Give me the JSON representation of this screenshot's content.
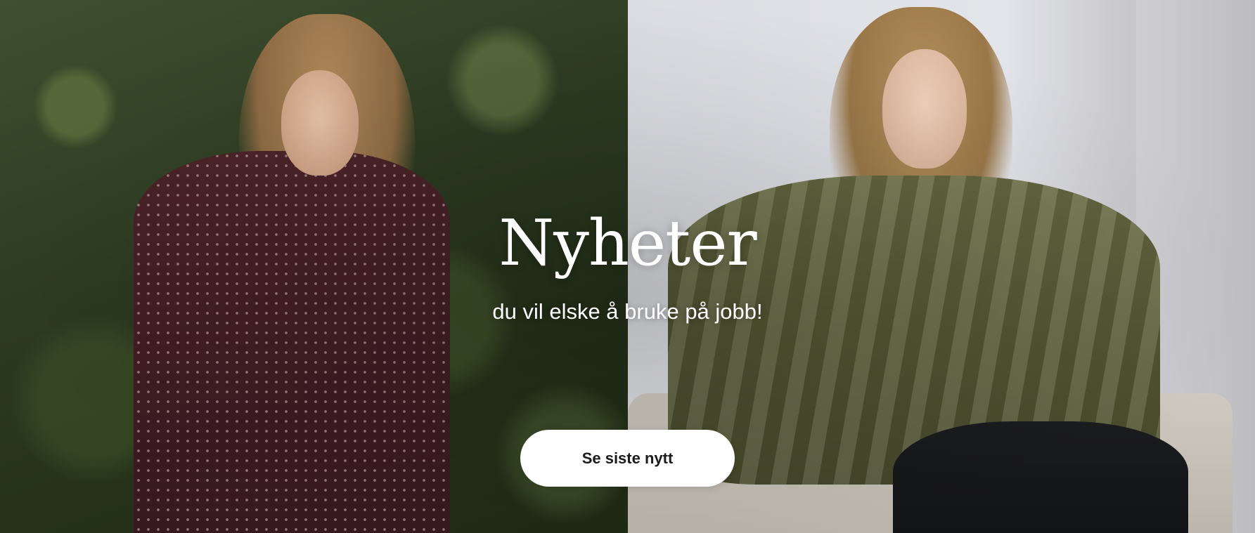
{
  "hero": {
    "title": "Nyheter",
    "subtitle": "du vil elske å bruke på jobb!",
    "cta_label": "Se siste nytt"
  },
  "images": {
    "left": "model-polka-dot-dress-hedge",
    "right": "model-green-satin-blouse-sofa"
  },
  "colors": {
    "text": "#ffffff",
    "button_bg": "#ffffff",
    "button_text": "#1b1b1b"
  }
}
